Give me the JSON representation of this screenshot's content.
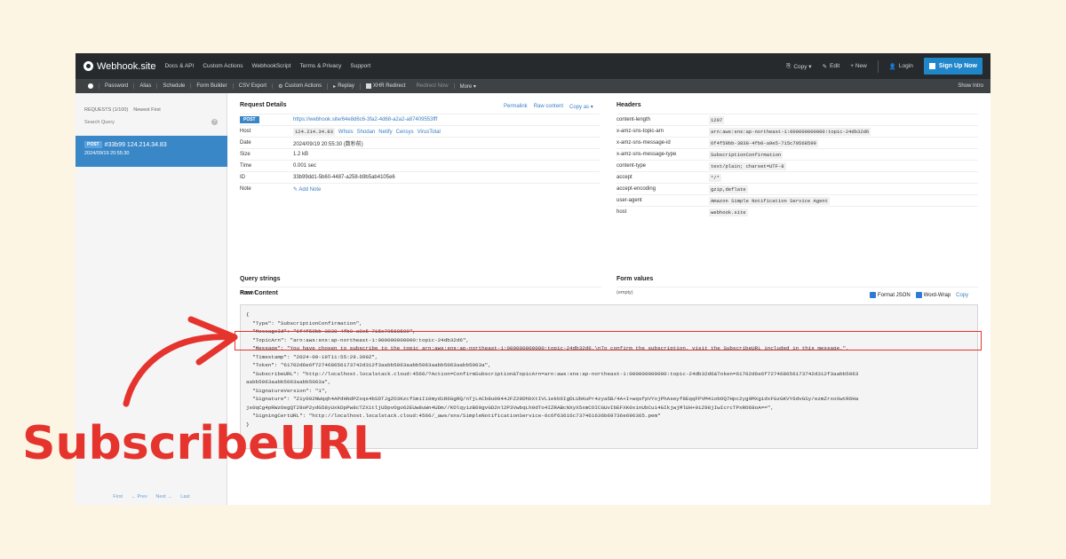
{
  "nav": {
    "brand": "Webhook.site",
    "links": [
      "Docs & API",
      "Custom Actions",
      "WebhookScript",
      "Terms & Privacy",
      "Support"
    ],
    "copy": "Copy ▾",
    "edit": "Edit",
    "new": "+ New",
    "login": "Login",
    "signup": "Sign Up Now"
  },
  "subnav": {
    "items": [
      "Password",
      "Alias",
      "Schedule",
      "Form Builder",
      "CSV Export",
      "Custom Actions",
      "Replay",
      "XHR Redirect",
      "Redirect Now",
      "More ▾"
    ],
    "show_intro": "Show Intro"
  },
  "sidebar": {
    "requests": "REQUESTS (1/100)",
    "order": "Newest First",
    "search_placeholder": "Search Query",
    "item_method": "POST",
    "item_title": "#33b99 124.214.34.83",
    "item_time": "2024/09/19 20:55:30",
    "pager": [
      "First",
      "← Prev",
      "Next →",
      "Last"
    ]
  },
  "details": {
    "title": "Request Details",
    "actions": [
      "Permalink",
      "Raw content",
      "Copy as ▾"
    ],
    "method": "POST",
    "url": "https://webhook.site/64e8d6c6-3fa2-4d68-a2a2-a87409553fff",
    "rows": [
      {
        "k": "Host",
        "v": "124.214.34.83"
      },
      {
        "k": "Date",
        "v": "2024/09/19 20:55:30 (数秒前)"
      },
      {
        "k": "Size",
        "v": "1.2 kB"
      },
      {
        "k": "Time",
        "v": "0.001 sec"
      },
      {
        "k": "ID",
        "v": "33b99dd1-5b60-4487-a258-b9b5ab4105e6"
      },
      {
        "k": "Note",
        "v": "Add Note"
      }
    ],
    "host_tools": [
      "Whois",
      "Shodan",
      "Netify",
      "Censys",
      "VirusTotal"
    ]
  },
  "headers": {
    "title": "Headers",
    "rows": [
      {
        "k": "content-length",
        "v": "1207"
      },
      {
        "k": "x-amz-sns-topic-arn",
        "v": "arn:aws:sns:ap-northeast-1:000000000000:topic-24db32d6"
      },
      {
        "k": "x-amz-sns-message-id",
        "v": "6f4f59bb-3838-4fb0-a9e5-715c79568599"
      },
      {
        "k": "x-amz-sns-message-type",
        "v": "SubscriptionConfirmation"
      },
      {
        "k": "content-type",
        "v": "text/plain; charset=UTF-8"
      },
      {
        "k": "accept",
        "v": "*/*"
      },
      {
        "k": "accept-encoding",
        "v": "gzip,deflate"
      },
      {
        "k": "user-agent",
        "v": "Amazon Simple Notification Service Agent"
      },
      {
        "k": "host",
        "v": "webhook.site"
      }
    ]
  },
  "query": {
    "title": "Query strings",
    "value": "(empty)"
  },
  "form": {
    "title": "Form values",
    "value": "(empty)"
  },
  "raw": {
    "title": "Raw Content",
    "format_json": "Format JSON",
    "word_wrap": "Word-Wrap",
    "copy": "Copy",
    "lines": [
      "{",
      "  \"Type\": \"SubscriptionConfirmation\",",
      "  \"MessageId\": \"6f4f59bb-3838-4fb0-a9e5-715c79568599\",",
      "  \"TopicArn\": \"arn:aws:sns:ap-northeast-1:000000000000:topic-24db32d6\",",
      "  \"Message\": \"You have chosen to subscribe to the topic arn:aws:sns:ap-northeast-1:000000000000:topic-24db32d6.\\nTo confirm the subscription, visit the SubscribeURL included in this message.\",",
      "  \"Timestamp\": \"2024-09-19T11:55:29.399Z\",",
      "  \"Token\": \"61702d6e6f727468656173742d312f3aabb5063aabb5063aabb5063aabb5063a\",",
      "  \"SubscribeURL\": \"http://localhost.localstack.cloud:4566/?Action=ConfirmSubscription&TopicArn=arn:aws:sns:ap-northeast-1:000000000000:topic-24db32d6&Token=61702d6e6f727468656173742d312f3aabb5063",
      "aabb5063aabb5063aabb5063a\",",
      "  \"SignatureVersion\": \"1\",",
      "  \"Signature\": \"Ziy002NWqqh4APdHNdPZxqs4bSDTJgZO3KzcfSmiI10mydiR6GgRQ/nTjLACb8u0044JFZ29DhbXtIVL1ekb6IgDLUbKuPr4zya5B/4A+I+wqsfpVYojPhAseyf8EqqFPVM41obOQ7Hpc2yg9MXgidxFGzGKVY6dvGSy/ezmZrxoXwtR6Ha",
      "js0qCg4pRWzOegQT28oP2ydG58yUxkDpPw8cTZX1tljUDpvOgo62EUw8uWn4UDm//KOlqy1zB60gvGD2nl2P3VwbqLh9dTo4IZRABcNXyX5xmCOICGUvIbEFXK0x1nUbCu14GIkjwjMlUH+9iZ98jIwIcrcTPxRO68oA==\",",
      "  \"SigningCertURL\": \"http://localhost.localstack.cloud:4566/_aws/sns/SimpleNotificationService-6c6f63616c737461636b69736e696365.pem\"",
      "}"
    ]
  },
  "annotation": {
    "label": "SubscribeURL",
    "color": "#e5332d"
  }
}
